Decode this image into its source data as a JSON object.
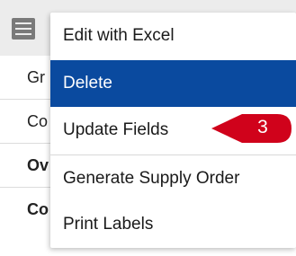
{
  "background": {
    "rows": [
      {
        "label": "Gr",
        "bold": false
      },
      {
        "label": "Co",
        "bold": false
      },
      {
        "label": "Ov",
        "bold": true
      },
      {
        "label": "Co",
        "bold": true
      }
    ]
  },
  "menu": {
    "items": [
      {
        "label": "Edit with Excel",
        "state": "normal"
      },
      {
        "label": "Delete",
        "state": "selected"
      },
      {
        "label": "Update Fields",
        "state": "normal"
      },
      {
        "label": "Generate Supply Order",
        "state": "normal"
      },
      {
        "label": "Print Labels",
        "state": "normal"
      }
    ]
  },
  "step_badge": {
    "number": "3",
    "color": "#d0021b"
  },
  "colors": {
    "selected_bg": "#0a4a9f",
    "selected_text": "#ffffff"
  },
  "icons": {
    "menu_toggle": "hamburger-menu-icon"
  }
}
